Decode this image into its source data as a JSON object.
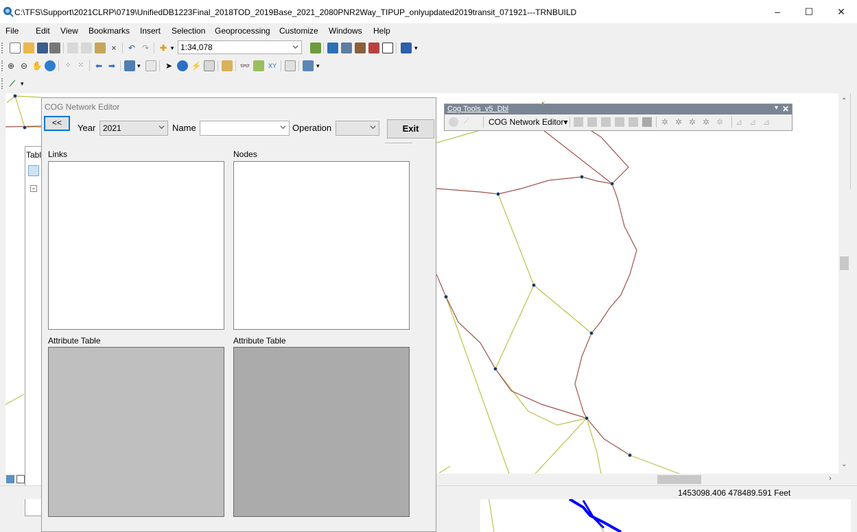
{
  "window": {
    "title": "C:\\TFS\\Support\\2021CLRP\\0719\\UnifiedDB1223Final_2018TOD_2019Base_2021_2080PNR2Way_TIPUP_onlyupdated2019transit_071921---TRNBUILD",
    "minimize": "–",
    "maximize": "☐",
    "close": "✕"
  },
  "menu": [
    "File",
    "Edit",
    "View",
    "Bookmarks",
    "Insert",
    "Selection",
    "Geoprocessing",
    "Customize",
    "Windows",
    "Help"
  ],
  "toolbar": {
    "scale_value": "1:34,078"
  },
  "toc": {
    "tab_label": "Tabl"
  },
  "status": {
    "coordinates": "1453098.406  478489.591 Feet"
  },
  "dialog": {
    "title": "COG Network Editor",
    "back_label": "<<",
    "year_label": "Year",
    "year_value": "2021",
    "name_label": "Name",
    "name_value": "",
    "operation_label": "Operation",
    "operation_value": "",
    "exit_label": "Exit",
    "links_label": "Links",
    "nodes_label": "Nodes",
    "attr_table_left_label": "Attribute Table",
    "attr_table_right_label": "Attribute Table"
  },
  "cog_tools": {
    "title": "Cog Tools_v5_Dbl",
    "dropdown_label": "COG Network Editor",
    "dropdown_arrow": "▾",
    "close": "✕",
    "menu_arrow": "▾"
  },
  "colors": {
    "road_brown": "#a0524a",
    "road_olive": "#bcc24a",
    "transit_blue": "#0000ff",
    "accent": "#0078d7"
  }
}
